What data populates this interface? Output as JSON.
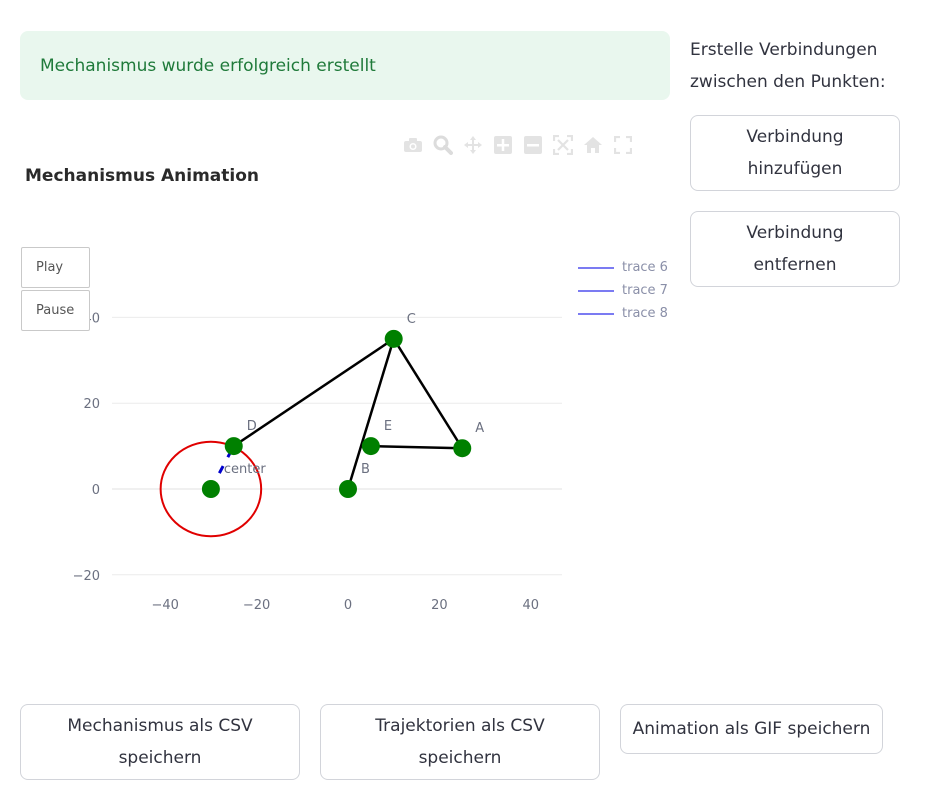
{
  "alert": {
    "text": "Mechanismus wurde erfolgreich erstellt"
  },
  "sidebar": {
    "instruction_line1": "Erstelle Verbindungen",
    "instruction_line2": "zwischen den Punkten:",
    "add_line1": "Verbindung",
    "add_line2": "hinzufügen",
    "remove_line1": "Verbindung",
    "remove_line2": "entfernen"
  },
  "toolbar": {
    "icons": [
      "camera-icon",
      "zoom-icon",
      "pan-icon",
      "zoom-in-icon",
      "zoom-out-icon",
      "autoscale-icon",
      "home-icon",
      "fullscreen-icon"
    ]
  },
  "chart": {
    "title": "Mechanismus Animation",
    "play_label": "Play",
    "pause_label": "Pause"
  },
  "chart_data": {
    "type": "scatter",
    "title": "Mechanismus Animation",
    "xlim": [
      -50,
      47
    ],
    "ylim": [
      -22,
      38
    ],
    "x_ticks": [
      -40,
      -20,
      0,
      20,
      40
    ],
    "y_ticks": [
      -20,
      0,
      20,
      40
    ],
    "grid": true,
    "points": [
      {
        "label": "A",
        "x": 25,
        "y": 9.5
      },
      {
        "label": "B",
        "x": 0,
        "y": 0
      },
      {
        "label": "C",
        "x": 10,
        "y": 35
      },
      {
        "label": "D",
        "x": -25,
        "y": 10
      },
      {
        "label": "E",
        "x": 5,
        "y": 10
      },
      {
        "label": "center",
        "x": -30,
        "y": 0
      }
    ],
    "links": [
      [
        "D",
        "C"
      ],
      [
        "C",
        "B"
      ],
      [
        "C",
        "A"
      ],
      [
        "E",
        "A"
      ]
    ],
    "crank_link": [
      "center",
      "D"
    ],
    "circle": {
      "center": [
        -30,
        0
      ],
      "radius": 11
    },
    "legend": [
      "trace 6",
      "trace 7",
      "trace 8"
    ],
    "colors": {
      "point": "#008000",
      "link": "#000000",
      "crank": "#0000cc",
      "circle": "#e00000",
      "legend_line": "#7b7bf2"
    }
  },
  "actions": {
    "csv_mech_line1": "Mechanismus als CSV",
    "csv_mech_line2": "speichern",
    "csv_traj_line1": "Trajektorien als CSV",
    "csv_traj_line2": "speichern",
    "gif_label": "Animation als GIF speichern"
  }
}
